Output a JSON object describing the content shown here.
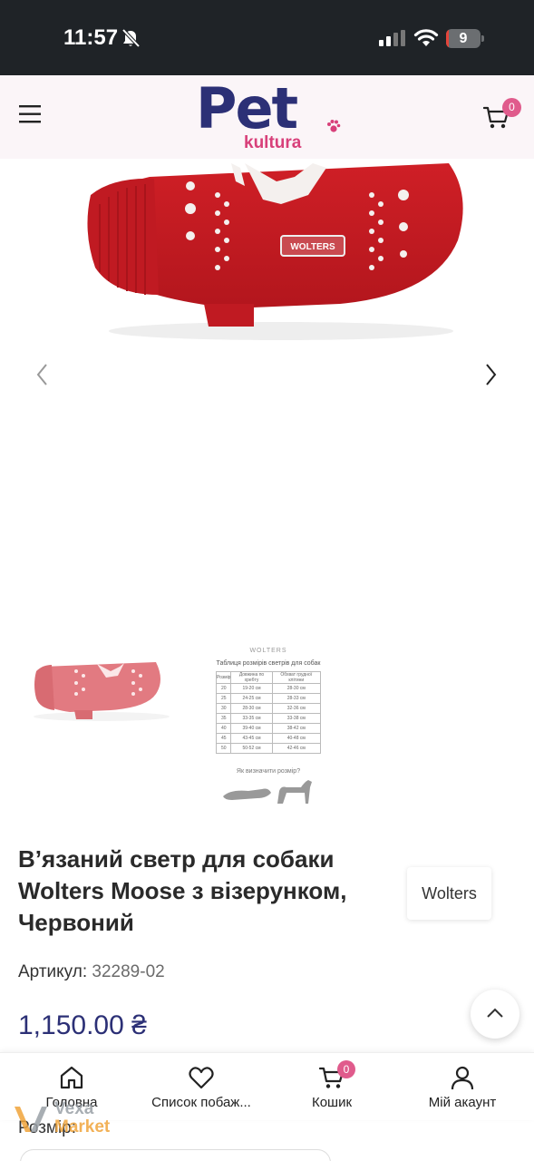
{
  "status_bar": {
    "time": "11:57",
    "battery": "9",
    "battery_percent": 9
  },
  "header": {
    "logo_primary": "Pet",
    "logo_secondary": "kultura",
    "cart_count": "0",
    "colors": {
      "brand_navy": "#2c3076",
      "brand_pink": "#d8407a",
      "badge": "#e05b8c"
    }
  },
  "gallery": {
    "main_image": "red knitted dog sweater",
    "sweater_tag": "WOLTERS",
    "thumbnails": [
      "red knitted dog sweater",
      "size chart"
    ]
  },
  "size_chart": {
    "brand": "WOLTERS",
    "title": "Таблиця розмірів светрів для собак",
    "headers": [
      "Розмір",
      "Довжина по хребту",
      "Обхват грудної клітини"
    ],
    "rows": [
      [
        "20",
        "19-20 см",
        "28-30 см"
      ],
      [
        "25",
        "24-25 см",
        "28-33 см"
      ],
      [
        "30",
        "28-30 см",
        "32-36 см"
      ],
      [
        "35",
        "33-35 см",
        "33-38 см"
      ],
      [
        "40",
        "39-40 см",
        "38-42 см"
      ],
      [
        "45",
        "43-45 см",
        "40-48 см"
      ],
      [
        "50",
        "50-52 см",
        "42-46 см"
      ]
    ],
    "question": "Як визначити розмір?"
  },
  "product": {
    "title_lines": [
      "В’язаний светр для собаки",
      "Wolters Moose з візерунком,",
      "Червоний"
    ],
    "brand": "Wolters",
    "sku_label": "Артикул:",
    "sku_value": "32289-02",
    "price": "1,150.00 ₴",
    "size_label": "Розмір:"
  },
  "bottom_nav": [
    {
      "label": "Головна",
      "icon": "home-icon"
    },
    {
      "label": "Список побаж...",
      "icon": "heart-icon"
    },
    {
      "label": "Кошик",
      "icon": "cart-icon",
      "badge": "0"
    },
    {
      "label": "Мій акаунт",
      "icon": "user-icon"
    }
  ],
  "watermark": {
    "line1": "Vexa",
    "line2": "Market"
  }
}
